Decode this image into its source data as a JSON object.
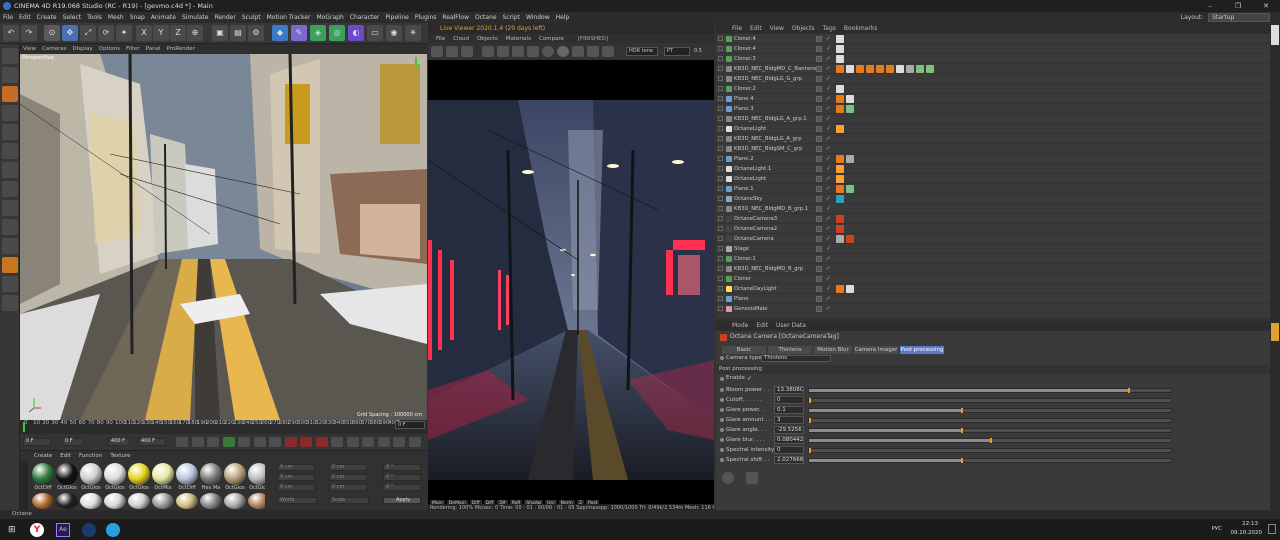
{
  "window": {
    "title": "CINEMA 4D R19.068 Studio (RC - R19) - [gevmo.c4d *] - Main",
    "minimize": "–",
    "maximize": "❐",
    "close": "✕"
  },
  "menubar": {
    "items": [
      "File",
      "Edit",
      "Create",
      "Select",
      "Tools",
      "Mesh",
      "Snap",
      "Animate",
      "Simulate",
      "Render",
      "Sculpt",
      "Motion Tracker",
      "MoGraph",
      "Character",
      "Pipeline",
      "Plugins",
      "RealFlow",
      "Octane",
      "Script",
      "Window",
      "Help"
    ]
  },
  "layout": {
    "label": "Layout:",
    "value": "Startup"
  },
  "viewport": {
    "menu": [
      "View",
      "Cameras",
      "Display",
      "Options",
      "Filter",
      "Panel",
      "ProRender"
    ],
    "name": "Perspective",
    "grid_spacing": "Grid Spacing : 100000 cm"
  },
  "timeline": {
    "ticks": [
      "0",
      "10",
      "20",
      "30",
      "40",
      "50",
      "60",
      "70",
      "80",
      "90",
      "100",
      "110",
      "120",
      "130",
      "140",
      "150",
      "160",
      "170",
      "180",
      "190",
      "200",
      "210",
      "220",
      "230",
      "240",
      "250",
      "260",
      "270",
      "280",
      "290",
      "300",
      "310",
      "320",
      "330",
      "340",
      "350",
      "360",
      "370",
      "380",
      "390",
      "400",
      "F"
    ],
    "frame_field": "0 F"
  },
  "transport": {
    "start": "0 F",
    "current": "0 F",
    "end": "400 F",
    "max": "400 F"
  },
  "materials": {
    "menu": [
      "Create",
      "Edit",
      "Function",
      "Texture"
    ],
    "row1": [
      {
        "name": "OctDiff",
        "color": "#2f7d3a"
      },
      {
        "name": "OctGlos",
        "color": "#111"
      },
      {
        "name": "OctGlos",
        "color": "#cfcfcf"
      },
      {
        "name": "OctGlos",
        "color": "#dcdcdc"
      },
      {
        "name": "OctGlos",
        "color": "#e6d21a"
      },
      {
        "name": "OctMix",
        "color": "#e6e6a0"
      },
      {
        "name": "OctDiff",
        "color": "#b9c4dc"
      },
      {
        "name": "Hex Ma",
        "color": "#7a7a7a"
      },
      {
        "name": "OctGlos",
        "color": "#b7a07a"
      },
      {
        "name": "OctGlos",
        "color": "#bcbcbc"
      }
    ],
    "row2": [
      {
        "name": "OctRoof",
        "color": "#b06a2e"
      },
      {
        "name": "OctDiff",
        "color": "#222"
      },
      {
        "name": "OctDiff",
        "color": "#e0e0e0"
      },
      {
        "name": "",
        "color": "#d8d8d8"
      },
      {
        "name": "",
        "color": "#cfcfcf"
      },
      {
        "name": "",
        "color": "#999"
      },
      {
        "name": "",
        "color": "#d0c080"
      },
      {
        "name": "",
        "color": "#888"
      },
      {
        "name": "",
        "color": "#aaa"
      },
      {
        "name": "",
        "color": "#b28060"
      }
    ]
  },
  "coords": {
    "x": "0 cm",
    "y": "0 cm",
    "z": "0 cm",
    "hx": "0 cm",
    "hy": "0 cm",
    "hz": "0 cm",
    "h": "0 °",
    "p": "0 °",
    "b": "0 °",
    "world": "World",
    "scale": "Scale",
    "apply": "Apply"
  },
  "liveviewer": {
    "title": "Live Viewer 2020.1.4 (29 days left)",
    "menu": [
      "File",
      "Cloud",
      "Objects",
      "Materials",
      "Compare"
    ],
    "status_tag": "[FINISHED]",
    "tonemap": "HDR tone",
    "pt": "PT",
    "value": "0.5",
    "channel_tabs": [
      "Main",
      "DeMain",
      "Diff",
      "Diff",
      "Dif",
      "Refl",
      "Shadw",
      "Unl",
      "Norm",
      "Z",
      "Post"
    ],
    "status": "Rendering: 100%  Ms/sec: 0   Time: 00 : 01 : 00/00 : 01 : 05   Spp/maxspp: 1000/1000   Tri: 0/49k/2.534m   Mesh: 116   Hair: 0"
  },
  "objmanager": {
    "menu": [
      "File",
      "Edit",
      "View",
      "Objects",
      "Tags",
      "Bookmarks"
    ],
    "objects": [
      {
        "name": "Cloner.4",
        "color": "#5aa05a",
        "tags": [
          "#ddd"
        ]
      },
      {
        "name": "Cloner.4",
        "color": "#5aa05a",
        "tags": [
          "#ddd"
        ]
      },
      {
        "name": "Cloner.3",
        "color": "#5aa05a",
        "tags": [
          "#ddd"
        ]
      },
      {
        "name": "KB3D_NEC_BldgMD_C_Banners",
        "color": "#888",
        "tags": [
          "#e87a20",
          "#ddd",
          "#e87a20",
          "#e87a20",
          "#e87a20",
          "#e87a20",
          "#ddd",
          "#aaa",
          "#7fbf7f",
          "#7fbf7f"
        ]
      },
      {
        "name": "KB3D_NEC_BldgLG_G_grp",
        "color": "#888",
        "tags": []
      },
      {
        "name": "Cloner.2",
        "color": "#5aa05a",
        "tags": [
          "#ddd"
        ]
      },
      {
        "name": "Plane.4",
        "color": "#6aa0d0",
        "tags": [
          "#e87a20",
          "#ddd"
        ]
      },
      {
        "name": "Plane.3",
        "color": "#6aa0d0",
        "tags": [
          "#e87a20",
          "#7fbf7f"
        ]
      },
      {
        "name": "KB3D_NEC_BldgLG_A_grp.1",
        "color": "#888",
        "tags": []
      },
      {
        "name": "OctaneLight",
        "color": "#ddd",
        "tags": [
          "#ffa030"
        ]
      },
      {
        "name": "KB3D_NEC_BldgLG_A_grp",
        "color": "#888",
        "tags": []
      },
      {
        "name": "KB3D_NEC_BldgSM_C_grp",
        "color": "#888",
        "tags": []
      },
      {
        "name": "Plane.2",
        "color": "#6aa0d0",
        "tags": [
          "#e87a20",
          "#aaa"
        ]
      },
      {
        "name": "OctaneLight.1",
        "color": "#ddd",
        "tags": [
          "#ffa030"
        ]
      },
      {
        "name": "OctaneLight",
        "color": "#ddd",
        "tags": [
          "#ffa030"
        ]
      },
      {
        "name": "Plane.1",
        "color": "#6aa0d0",
        "tags": [
          "#e87a20",
          "#7fbf7f"
        ]
      },
      {
        "name": "OctaneSky",
        "color": "#8ab",
        "tags": [
          "#2aa0c0"
        ]
      },
      {
        "name": "KB3D_NEC_BldgMD_B_grp.1",
        "color": "#888",
        "tags": []
      },
      {
        "name": "OctaneCamera3",
        "color": "#444",
        "tags": [
          "#d04020"
        ]
      },
      {
        "name": "OctaneCamera2",
        "color": "#444",
        "tags": [
          "#d04020"
        ]
      },
      {
        "name": "OctaneCamera",
        "color": "#444",
        "tags": [
          "#aaa",
          "#d04020"
        ]
      },
      {
        "name": "Stage",
        "color": "#aaa",
        "tags": []
      },
      {
        "name": "Cloner.1",
        "color": "#5aa05a",
        "tags": []
      },
      {
        "name": "KB3D_NEC_BldgMD_B_grp",
        "color": "#888",
        "tags": []
      },
      {
        "name": "Cloner",
        "color": "#5aa05a",
        "tags": []
      },
      {
        "name": "OctaneDayLight",
        "color": "#ffdd55",
        "tags": [
          "#e87a20",
          "#ddd"
        ]
      },
      {
        "name": "Plane",
        "color": "#6aa0d0",
        "tags": []
      },
      {
        "name": "GenesisMale",
        "color": "#d9a",
        "tags": []
      }
    ]
  },
  "attributes": {
    "menu": [
      "Mode",
      "Edit",
      "User Data"
    ],
    "object": "Octane Camera [OctaneCameraTag]",
    "tabs": [
      "Basic",
      "Thinlens",
      "Motion Blur",
      "Camera Imager",
      "Post processing"
    ],
    "active_tab": "Post processing",
    "camera_type_label": "Camera type",
    "camera_type": "Thinlens",
    "section": "Post processing",
    "enable_label": "Enable",
    "enable": "✓",
    "params": [
      {
        "label": "Bloom power . .",
        "value": "13.3808C",
        "fill": 0.88
      },
      {
        "label": "Cutoff. . . . . .",
        "value": "0",
        "fill": 0.0
      },
      {
        "label": "Glare power. .",
        "value": "0.1",
        "fill": 0.42
      },
      {
        "label": "Glare amount . .",
        "value": "3",
        "fill": 0.0
      },
      {
        "label": "Glare angle. . .",
        "value": "-29.5256",
        "fill": 0.42
      },
      {
        "label": "Glare blur. . . .",
        "value": "0.080442",
        "fill": 0.5
      },
      {
        "label": "Spectral intensity",
        "value": "0",
        "fill": 0.0
      },
      {
        "label": "Spectral shift . .",
        "value": "2.027668",
        "fill": 0.42
      }
    ]
  },
  "taskbar": {
    "time": "22:13",
    "date": "09.10.2020",
    "lang": "РУС",
    "octane": "Octane"
  },
  "accent": "#e0a030"
}
